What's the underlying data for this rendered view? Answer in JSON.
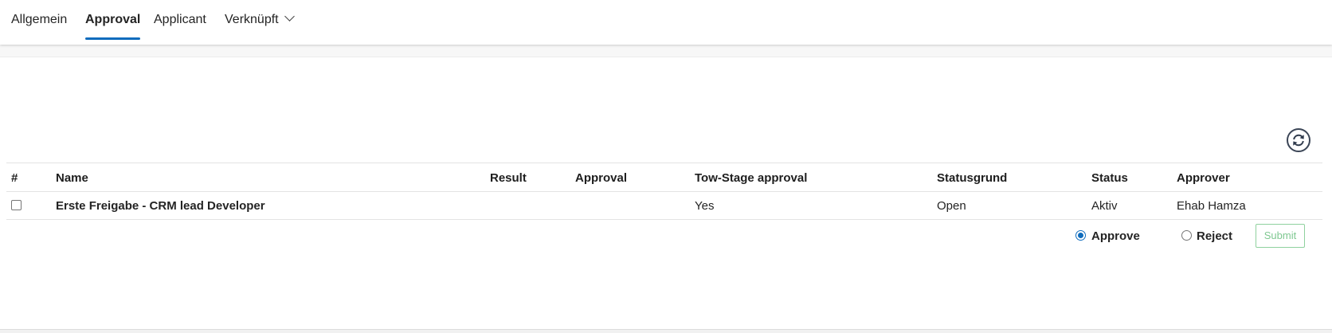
{
  "tabs": {
    "allgemein": "Allgemein",
    "approval": "Approval",
    "applicant": "Applicant",
    "verknuepft": "Verknüpft"
  },
  "table": {
    "headers": {
      "index": "#",
      "name": "Name",
      "result": "Result",
      "approval": "Approval",
      "two_stage": "Tow-Stage approval",
      "statusgrund": "Statusgrund",
      "status": "Status",
      "approver": "Approver"
    },
    "rows": [
      {
        "checked": false,
        "name": "Erste Freigabe - CRM lead Developer",
        "result": "",
        "approval": "",
        "two_stage": "Yes",
        "statusgrund": "Open",
        "status": "Aktiv",
        "approver": "Ehab Hamza"
      }
    ]
  },
  "decision": {
    "approve_label": "Approve",
    "reject_label": "Reject",
    "selected": "Approve",
    "submit_label": "Submit"
  },
  "colors": {
    "accent": "#0f6cbd",
    "submit_border": "#8fd19e",
    "submit_text": "#7fc891"
  },
  "icons": {
    "refresh": "refresh-icon",
    "dropdown": "chevron-down-icon"
  }
}
